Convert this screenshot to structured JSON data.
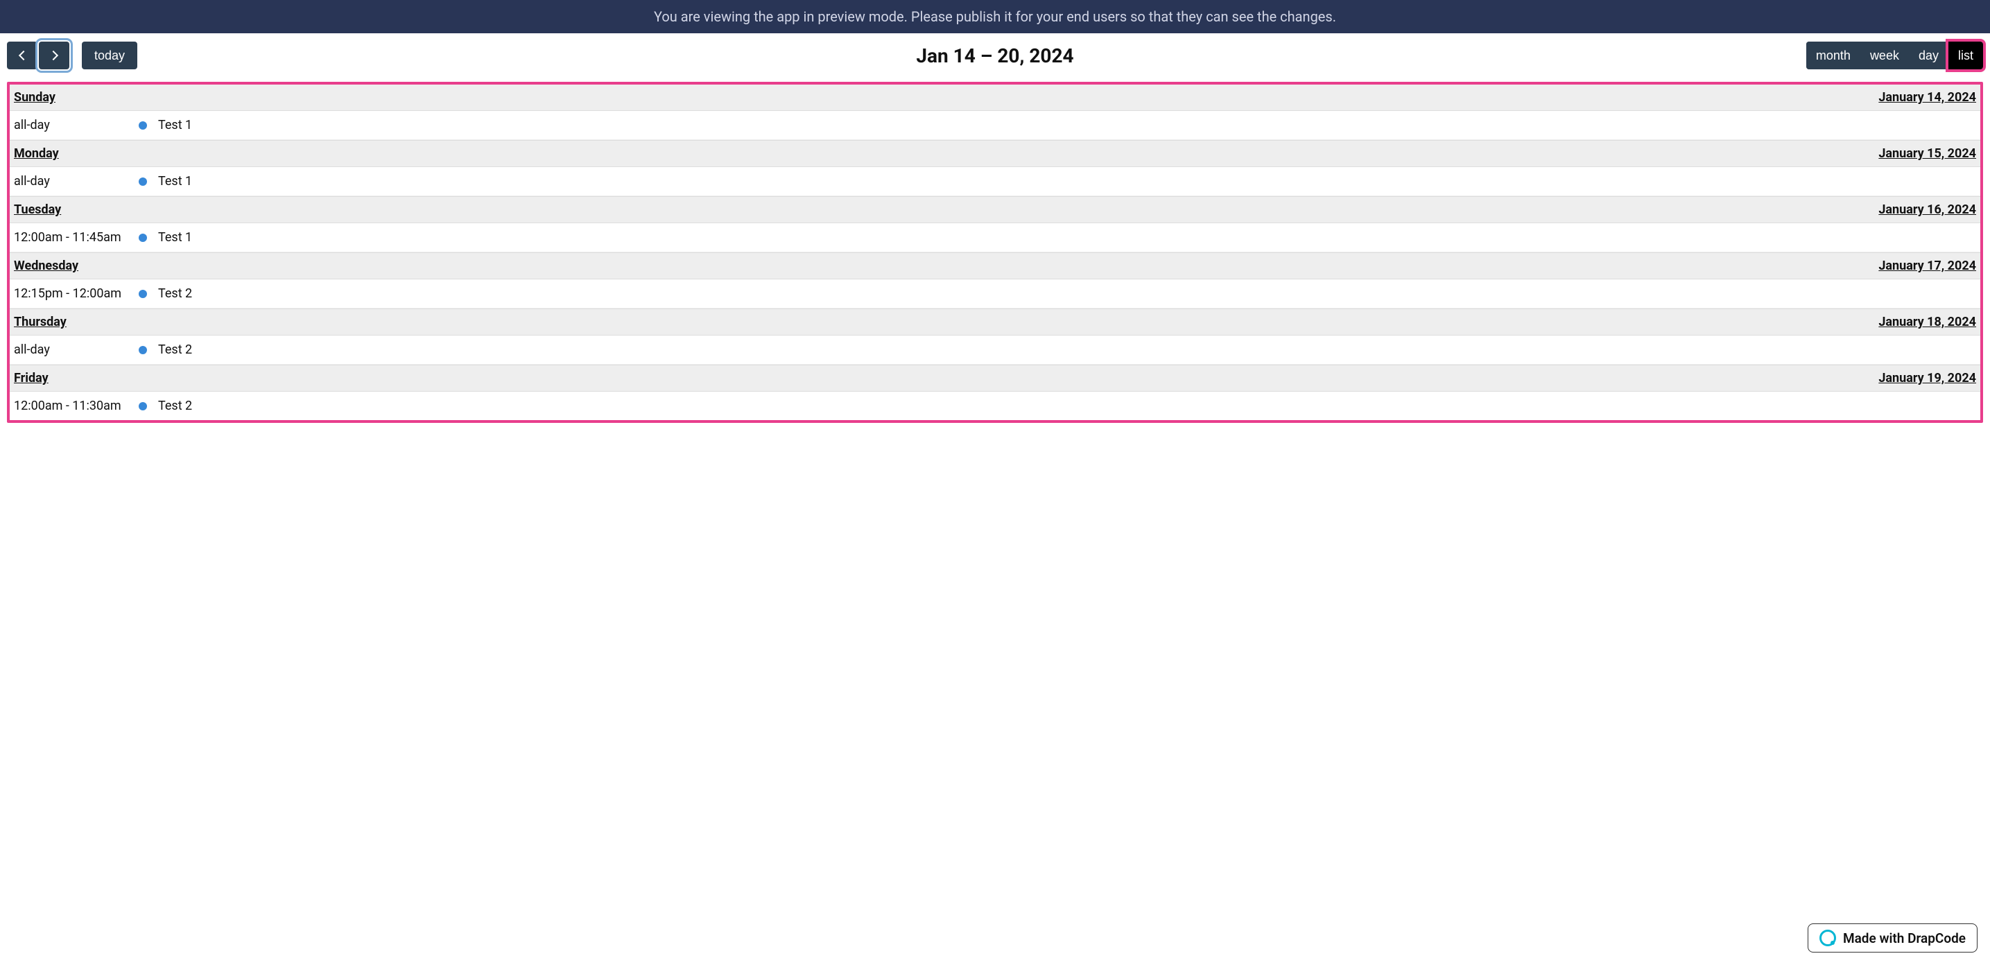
{
  "banner": {
    "text": "You are viewing the app in preview mode. Please publish it for your end users so that they can see the changes."
  },
  "toolbar": {
    "today_label": "today",
    "title": "Jan 14 – 20, 2024",
    "views": {
      "month": "month",
      "week": "week",
      "day": "day",
      "list": "list"
    }
  },
  "days": [
    {
      "name": "Sunday",
      "date": "January 14, 2024",
      "events": [
        {
          "time": "all-day",
          "title": "Test 1",
          "color": "#3788d8"
        }
      ]
    },
    {
      "name": "Monday",
      "date": "January 15, 2024",
      "events": [
        {
          "time": "all-day",
          "title": "Test 1",
          "color": "#3788d8"
        }
      ]
    },
    {
      "name": "Tuesday",
      "date": "January 16, 2024",
      "events": [
        {
          "time": "12:00am - 11:45am",
          "title": "Test 1",
          "color": "#3788d8"
        }
      ]
    },
    {
      "name": "Wednesday",
      "date": "January 17, 2024",
      "events": [
        {
          "time": "12:15pm - 12:00am",
          "title": "Test 2",
          "color": "#3788d8"
        }
      ]
    },
    {
      "name": "Thursday",
      "date": "January 18, 2024",
      "events": [
        {
          "time": "all-day",
          "title": "Test 2",
          "color": "#3788d8"
        }
      ]
    },
    {
      "name": "Friday",
      "date": "January 19, 2024",
      "events": [
        {
          "time": "12:00am - 11:30am",
          "title": "Test 2",
          "color": "#3788d8"
        }
      ]
    }
  ],
  "footer": {
    "badge_text": "Made with DrapCode"
  }
}
